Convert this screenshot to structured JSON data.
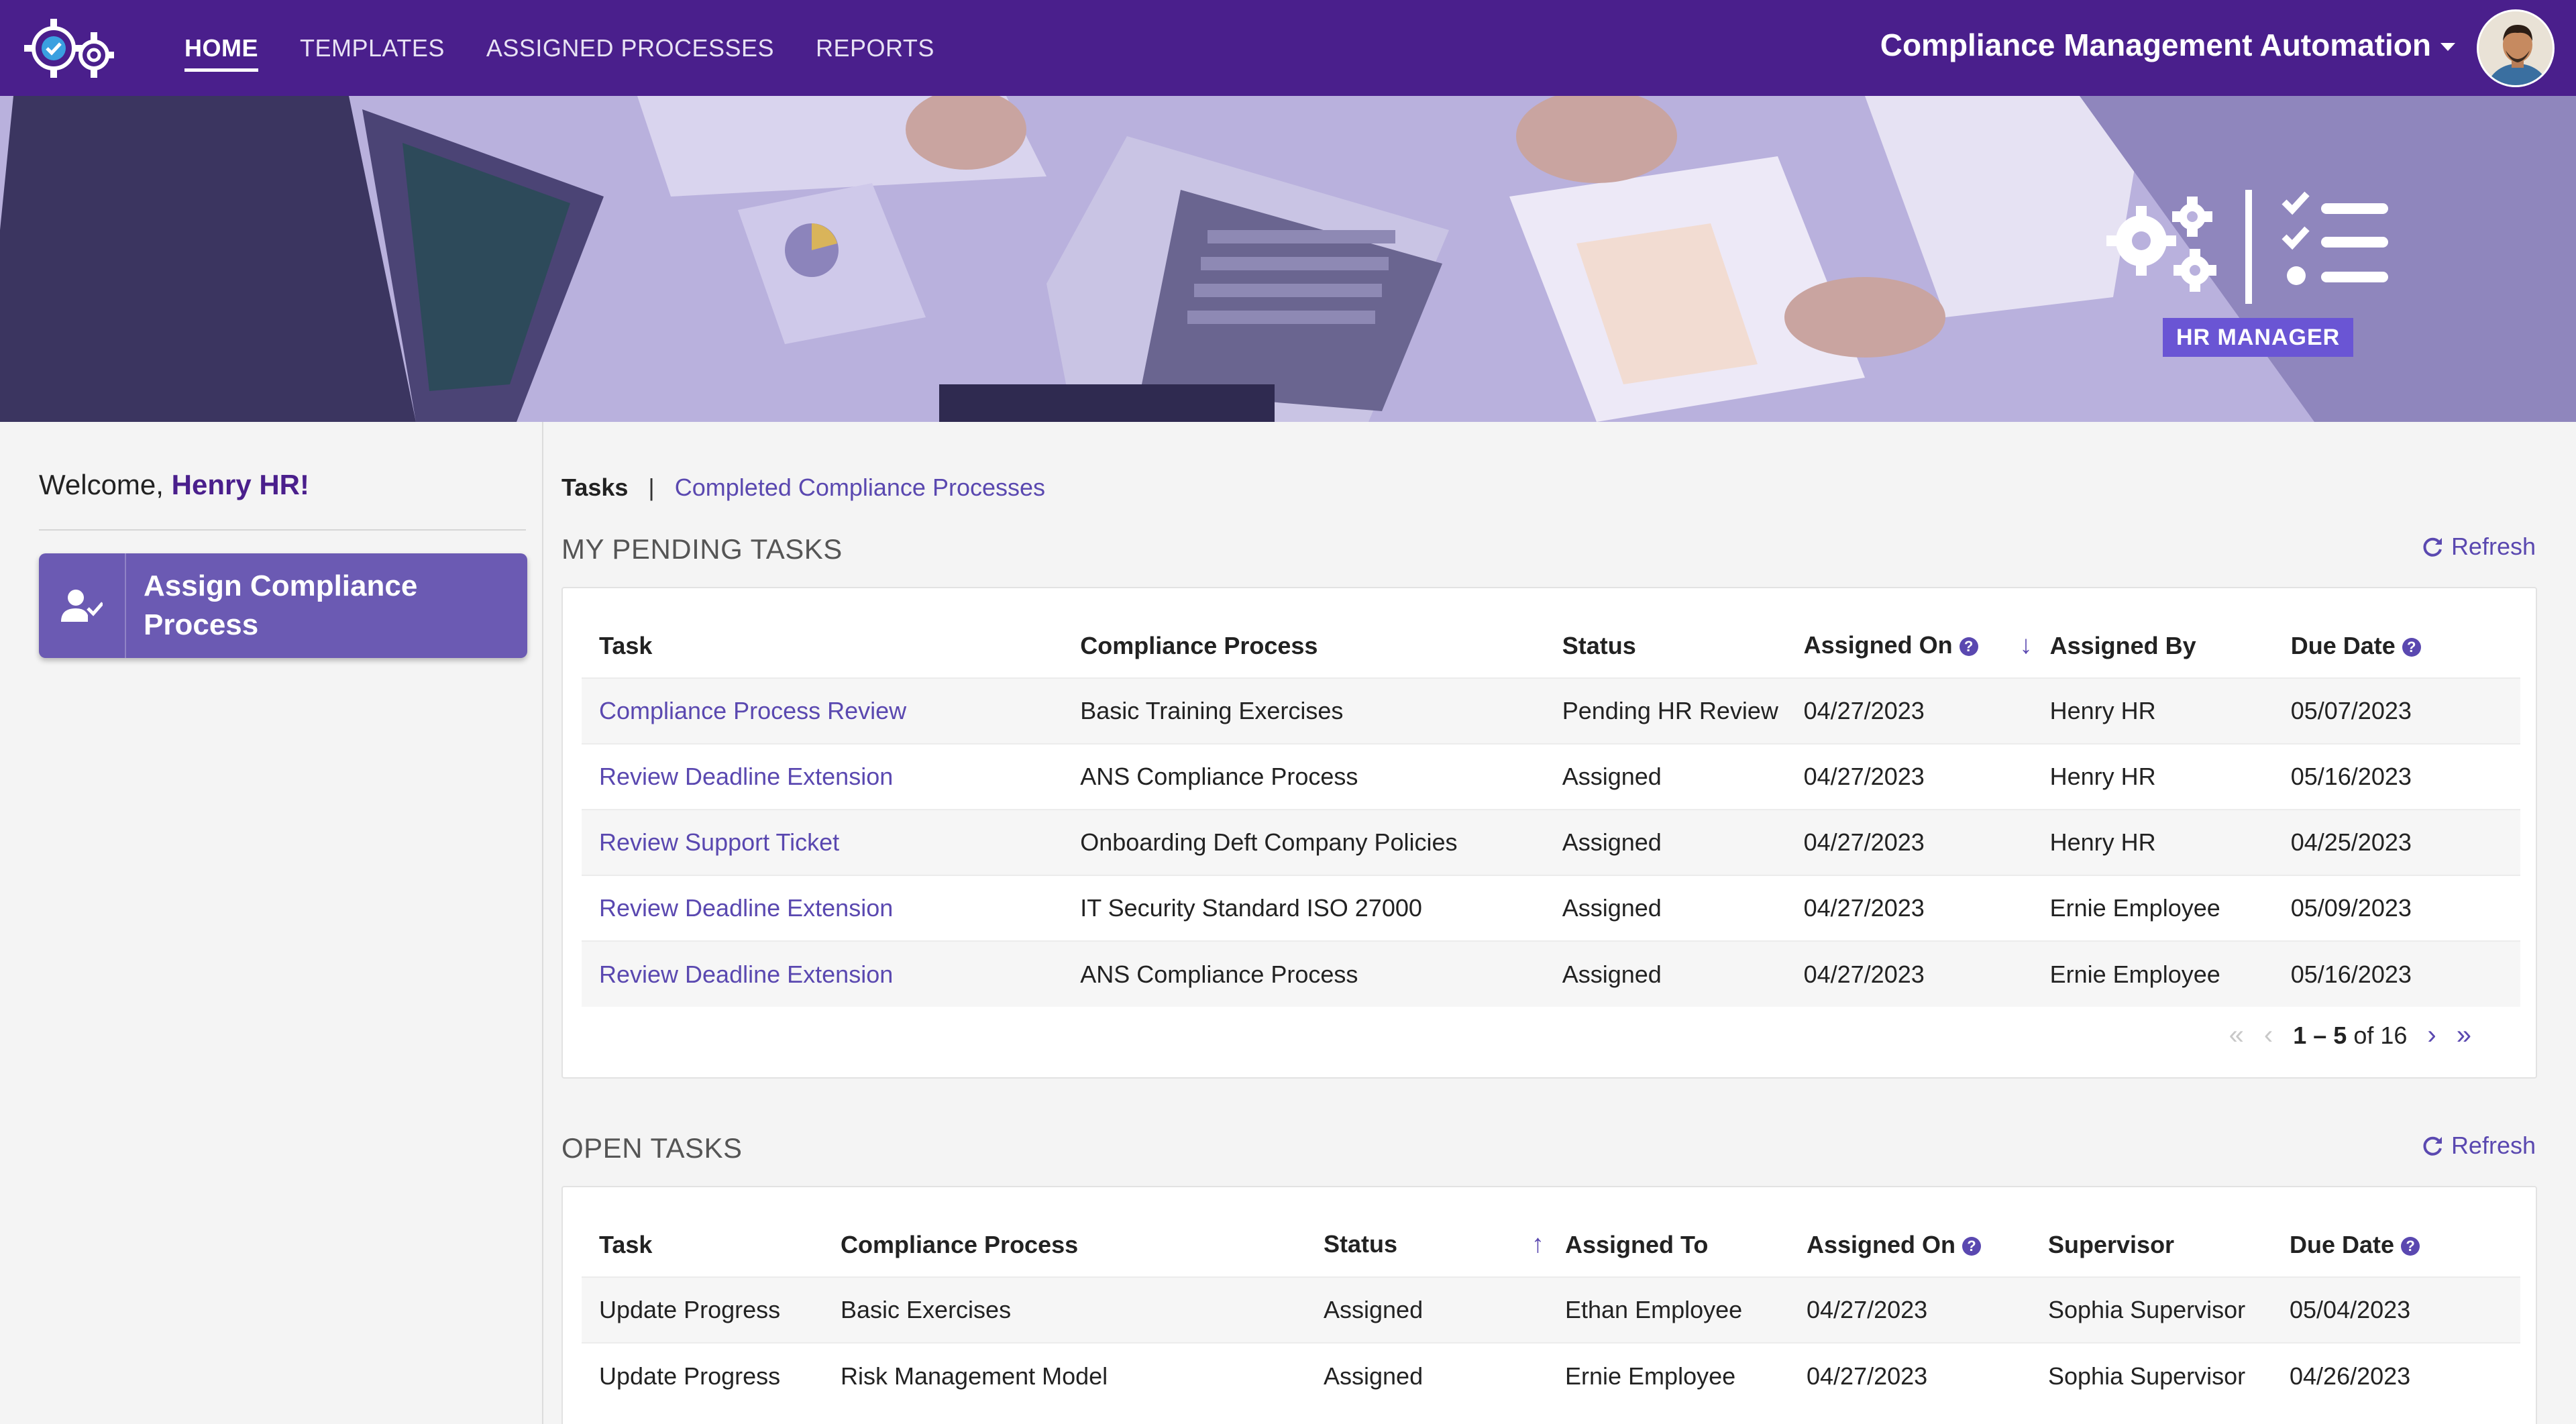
{
  "nav": {
    "items": [
      {
        "label": "HOME",
        "active": true
      },
      {
        "label": "TEMPLATES",
        "active": false
      },
      {
        "label": "ASSIGNED PROCESSES",
        "active": false
      },
      {
        "label": "REPORTS",
        "active": false
      }
    ],
    "app_title": "Compliance Management Automation"
  },
  "banner": {
    "role": "HR MANAGER"
  },
  "left": {
    "welcome_prefix": "Welcome,",
    "user_name": "Henry HR!",
    "assign_button": "Assign Compliance Process"
  },
  "subtabs": {
    "active": "Tasks",
    "separator": "|",
    "other": "Completed Compliance Processes"
  },
  "pending": {
    "title": "MY PENDING TASKS",
    "refresh": "Refresh",
    "columns": [
      "Task",
      "Compliance Process",
      "Status",
      "Assigned On",
      "Assigned By",
      "Due Date"
    ],
    "rows": [
      [
        "Compliance Process Review",
        "Basic Training Exercises",
        "Pending HR Review",
        "04/27/2023",
        "Henry HR",
        "05/07/2023"
      ],
      [
        "Review Deadline Extension",
        "ANS Compliance Process",
        "Assigned",
        "04/27/2023",
        "Henry HR",
        "05/16/2023"
      ],
      [
        "Review Support Ticket",
        "Onboarding Deft Company Policies",
        "Assigned",
        "04/27/2023",
        "Henry HR",
        "04/25/2023"
      ],
      [
        "Review Deadline Extension",
        "IT Security Standard ISO 27000",
        "Assigned",
        "04/27/2023",
        "Ernie Employee",
        "05/09/2023"
      ],
      [
        "Review Deadline Extension",
        "ANS Compliance Process",
        "Assigned",
        "04/27/2023",
        "Ernie Employee",
        "05/16/2023"
      ]
    ],
    "pager": {
      "range": "1 – 5",
      "of": "of 16"
    }
  },
  "open": {
    "title": "OPEN TASKS",
    "refresh": "Refresh",
    "columns": [
      "Task",
      "Compliance Process",
      "Status",
      "Assigned To",
      "Assigned On",
      "Supervisor",
      "Due Date"
    ],
    "rows": [
      [
        "Update Progress",
        "Basic Exercises",
        "Assigned",
        "Ethan Employee",
        "04/27/2023",
        "Sophia Supervisor",
        "05/04/2023"
      ],
      [
        "Update Progress",
        "Risk Management Model",
        "Assigned",
        "Ernie Employee",
        "04/27/2023",
        "Sophia Supervisor",
        "04/26/2023"
      ]
    ]
  },
  "icons": {
    "logo": "gears-check-icon",
    "help": "question-circle-icon",
    "refresh": "refresh-icon",
    "assign": "user-check-icon",
    "role": "gears-checklist-icon"
  },
  "colors": {
    "nav_bg": "#4a1f8c",
    "accent": "#5a48b0",
    "button": "#6b5ab3",
    "badge": "#6a55d4"
  }
}
